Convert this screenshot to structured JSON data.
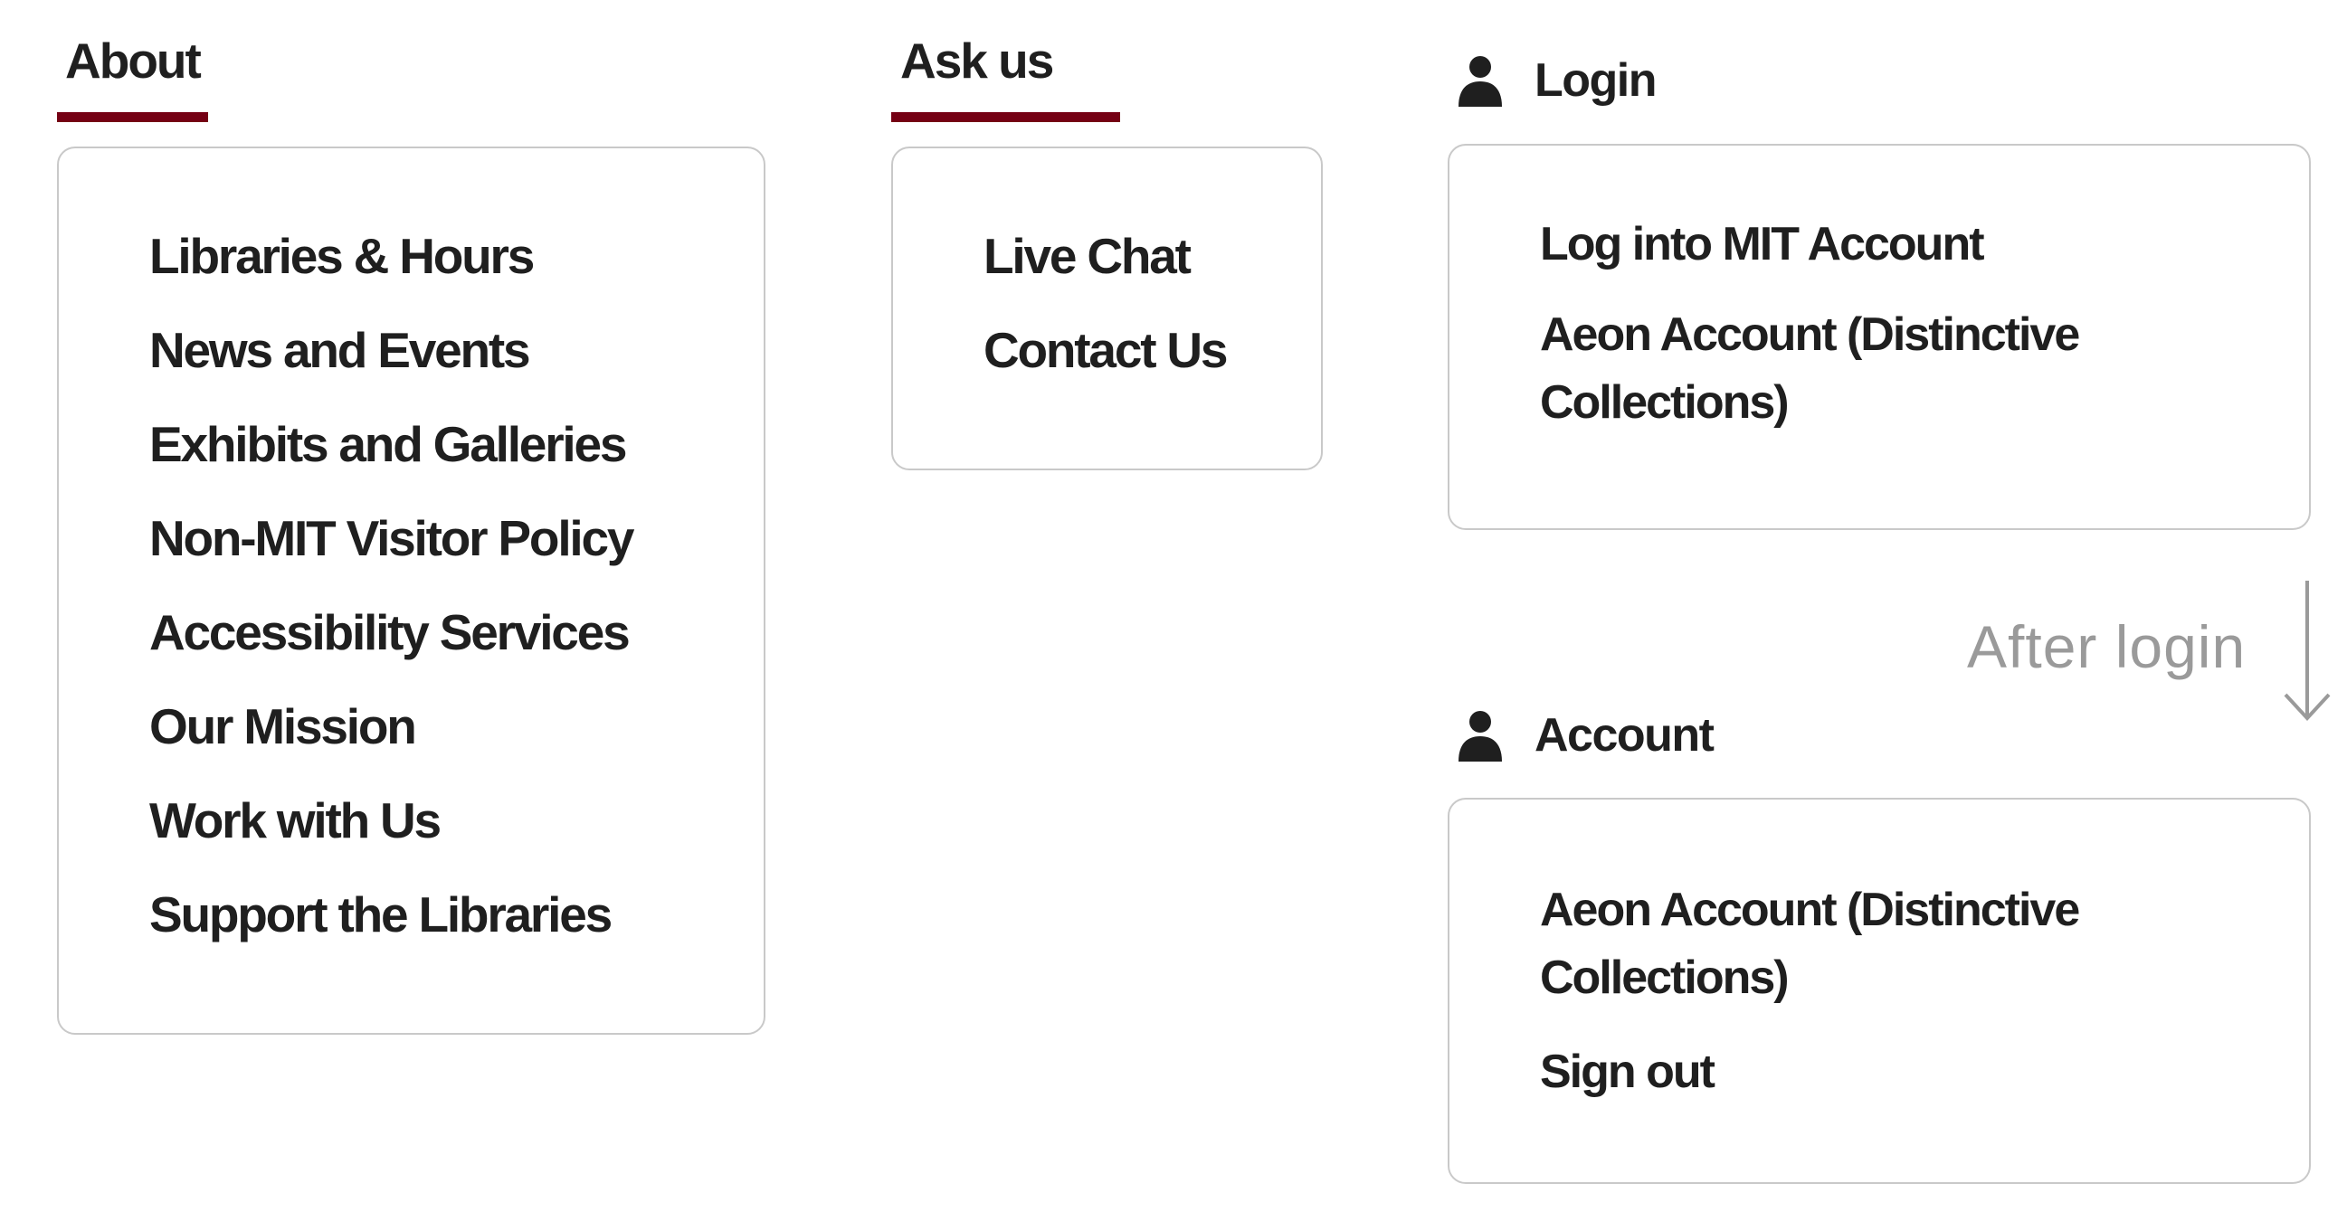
{
  "about": {
    "title": "About",
    "items": [
      "Libraries & Hours",
      "News and Events",
      "Exhibits and Galleries",
      "Non-MIT Visitor Policy",
      "Accessibility Services",
      "Our Mission",
      "Work with Us",
      "Support the Libraries"
    ]
  },
  "ask": {
    "title": "Ask us",
    "items": [
      "Live Chat",
      "Contact Us"
    ]
  },
  "login": {
    "title": "Login",
    "items": [
      "Log into MIT Account",
      "Aeon Account (Distinctive Collections)"
    ]
  },
  "annotation": {
    "text": "After login"
  },
  "account": {
    "title": "Account",
    "items": [
      "Aeon Account (Distinctive Collections)",
      "Sign out"
    ]
  },
  "colors": {
    "accent": "#750014",
    "border": "#c9c9c9",
    "annotation": "#9a9a9a",
    "text": "#1f1f1f"
  },
  "icons": {
    "user": "person-icon",
    "arrow": "arrow-down-icon"
  }
}
